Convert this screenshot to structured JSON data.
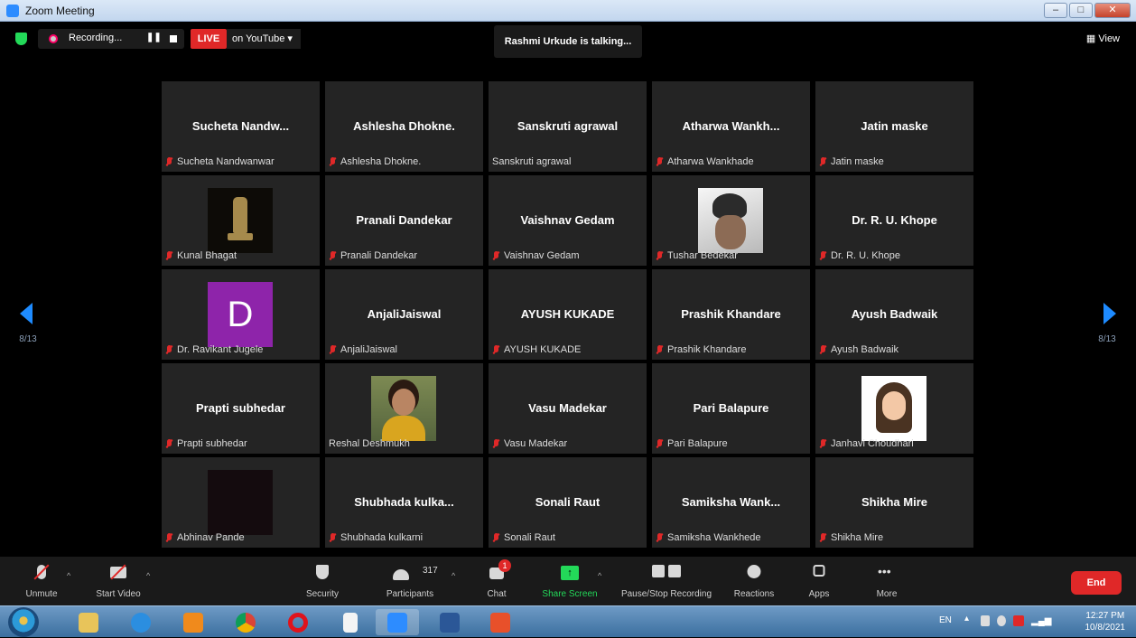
{
  "window": {
    "title": "Zoom Meeting"
  },
  "topbar": {
    "recording_label": "Recording...",
    "live_badge": "LIVE",
    "live_target": "on YouTube ▾",
    "talking": "Rashmi Urkude is talking...",
    "view_label": "▦ View"
  },
  "nav": {
    "left_page": "8/13",
    "right_page": "8/13"
  },
  "tiles": [
    {
      "name": "Sucheta  Nandw...",
      "label": "Sucheta Nandwanwar",
      "muted": true
    },
    {
      "name": "Ashlesha Dhokne.",
      "label": "Ashlesha Dhokne.",
      "muted": true
    },
    {
      "name": "Sanskruti agrawal",
      "label": "Sanskruti agrawal",
      "muted": false
    },
    {
      "name": "Atharwa  Wankh...",
      "label": "Atharwa Wankhade",
      "muted": true
    },
    {
      "name": "Jatin maske",
      "label": "Jatin maske",
      "muted": true
    },
    {
      "name": "",
      "label": "Kunal Bhagat",
      "muted": true,
      "pic": "emblem"
    },
    {
      "name": "Pranali Dandekar",
      "label": "Pranali Dandekar",
      "muted": true
    },
    {
      "name": "Vaishnav Gedam",
      "label": "Vaishnav Gedam",
      "muted": true
    },
    {
      "name": "",
      "label": "Tushar Bedekar",
      "muted": true,
      "pic": "tushar"
    },
    {
      "name": "Dr. R. U. Khope",
      "label": "Dr. R. U. Khope",
      "muted": true
    },
    {
      "name": "",
      "label": "Dr. Ravikant Jugele",
      "muted": true,
      "pic": "dpic",
      "initial": "D"
    },
    {
      "name": "AnjaliJaiswal",
      "label": "AnjaliJaiswal",
      "muted": true
    },
    {
      "name": "AYUSH KUKADE",
      "label": "AYUSH KUKADE",
      "muted": true
    },
    {
      "name": "Prashik Khandare",
      "label": "Prashik Khandare",
      "muted": true
    },
    {
      "name": "Ayush Badwaik",
      "label": "Ayush Badwaik",
      "muted": true
    },
    {
      "name": "Prapti subhedar",
      "label": "Prapti subhedar",
      "muted": true
    },
    {
      "name": "",
      "label": "Reshal Deshmukh",
      "muted": false,
      "pic": "reshal"
    },
    {
      "name": "Vasu Madekar",
      "label": "Vasu Madekar",
      "muted": true
    },
    {
      "name": "Pari Balapure",
      "label": "Pari Balapure",
      "muted": true
    },
    {
      "name": "",
      "label": "Janhavi Choudhari",
      "muted": true,
      "pic": "janhavi"
    },
    {
      "name": "",
      "label": "Abhinav Pande",
      "muted": true,
      "pic": "abhinav"
    },
    {
      "name": "Shubhada  kulka...",
      "label": "Shubhada kulkarni",
      "muted": true
    },
    {
      "name": "Sonali Raut",
      "label": "Sonali Raut",
      "muted": true
    },
    {
      "name": "Samiksha  Wank...",
      "label": "Samiksha Wankhede",
      "muted": true
    },
    {
      "name": "Shikha Mire",
      "label": "Shikha Mire",
      "muted": true
    }
  ],
  "toolbar": {
    "unmute": "Unmute",
    "start_video": "Start Video",
    "security": "Security",
    "participants": "Participants",
    "participants_count": "317",
    "chat": "Chat",
    "chat_badge": "1",
    "share_screen": "Share Screen",
    "pause_stop": "Pause/Stop Recording",
    "reactions": "Reactions",
    "apps": "Apps",
    "more": "More",
    "end": "End"
  },
  "taskbar": {
    "lang": "EN",
    "time": "12:27 PM",
    "date": "10/8/2021",
    "share_color": "#23d959",
    "end_color": "#e02828"
  }
}
